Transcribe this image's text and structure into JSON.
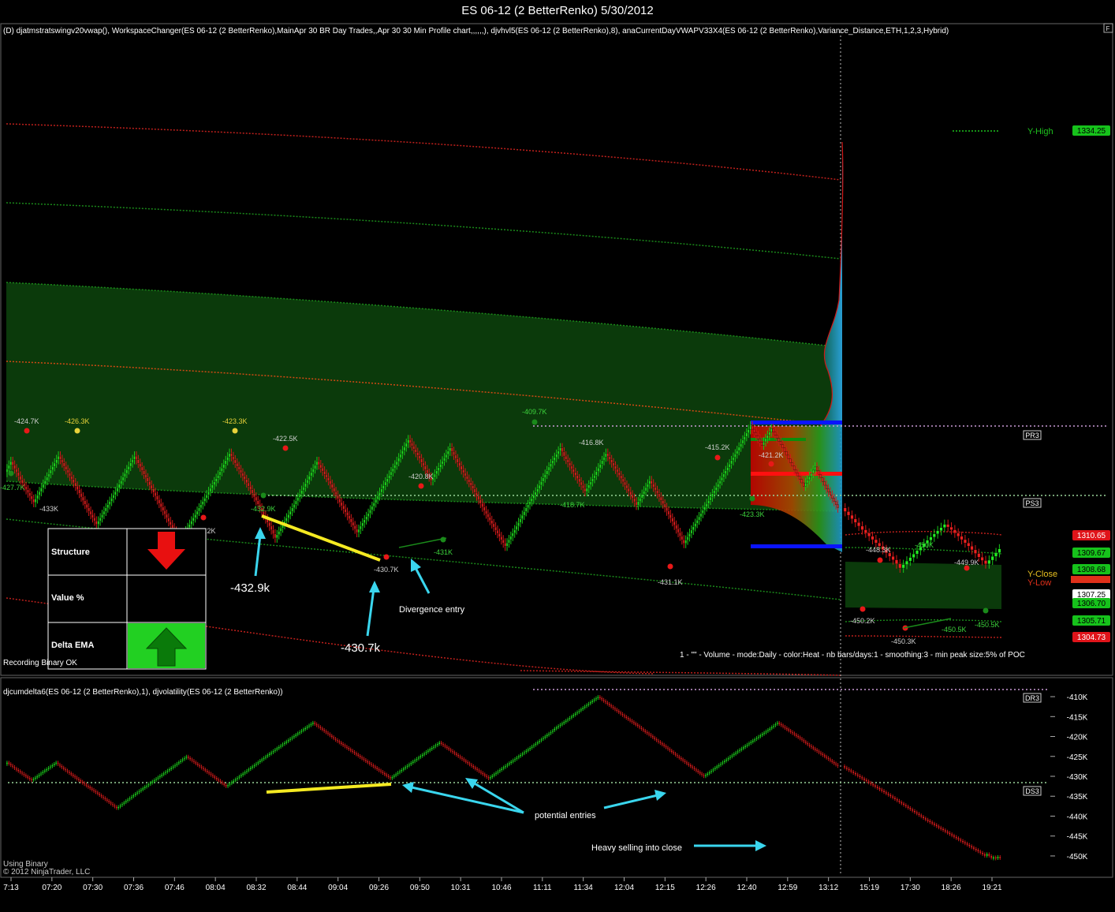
{
  "window": {
    "title": "ES 06-12 (2 BetterRenko)  5/30/2012",
    "corner_button": "F"
  },
  "price_panel": {
    "indicators": "(D) djatmstratswingv20vwap(), WorkspaceChanger(ES 06-12 (2 BetterRenko),MainApr 30 BR Day Trades,,Apr 30 30 Min Profile chart,,,,,,), djvhvl5(ES 06-12 (2 BetterRenko),8), anaCurrentDayVWAPV33X4(ES 06-12 (2 BetterRenko),Variance_Distance,ETH,1,2,3,Hybrid)",
    "status": "Recording Binary OK",
    "profile_caption": "1 - \"\" - Volume - mode:Daily  - color:Heat - nb bars/days:1 - smoothing:3 - min peak size:5% of POC",
    "level_tags": [
      "PR3",
      "PS3"
    ],
    "level_text": {
      "y_high": "Y-High",
      "y_close": "Y-Close",
      "y_low": "Y-Low"
    },
    "price_boxes": [
      {
        "label": "1334.25",
        "color": "#16c21b"
      },
      {
        "label": "1310.65",
        "color": "#e0141a"
      },
      {
        "label": "1309.67",
        "color": "#16c21b"
      },
      {
        "label": "1308.68",
        "color": "#16c21b"
      },
      {
        "label": "1307.25",
        "color": "#ffffff"
      },
      {
        "label": "1306.70",
        "color": "#16c21b"
      },
      {
        "label": "1305.71",
        "color": "#16c21b"
      },
      {
        "label": "1304.73",
        "color": "#e0141a"
      }
    ],
    "swing_labels": [
      {
        "text": "-424.7K",
        "color": "#cfcfcf"
      },
      {
        "text": "-426.3K",
        "color": "#e8d23a"
      },
      {
        "text": "-423.3K",
        "color": "#e8d23a"
      },
      {
        "text": "-422.5K",
        "color": "#cfcfcf"
      },
      {
        "text": "-420.8K",
        "color": "#cfcfcf"
      },
      {
        "text": "-409.7K",
        "color": "#3cd23c"
      },
      {
        "text": "-416.8K",
        "color": "#cfcfcf"
      },
      {
        "text": "-415.2K",
        "color": "#cfcfcf"
      },
      {
        "text": "-421.2K",
        "color": "#cfcfcf"
      },
      {
        "text": "-427.7K",
        "color": "#3cd23c"
      },
      {
        "text": "-433K",
        "color": "#cfcfcf"
      },
      {
        "text": "-440.2K",
        "color": "#cfcfcf"
      },
      {
        "text": "-432.9K",
        "color": "#3cd23c"
      },
      {
        "text": "-430.7K",
        "color": "#cfcfcf"
      },
      {
        "text": "-431K",
        "color": "#3cd23c"
      },
      {
        "text": "-418.7K",
        "color": "#3cd23c"
      },
      {
        "text": "-431.1K",
        "color": "#cfcfcf"
      },
      {
        "text": "-423.3K",
        "color": "#3cd23c"
      },
      {
        "text": "-448.3K",
        "color": "#cfcfcf"
      },
      {
        "text": "-450K",
        "color": "#3cd23c"
      },
      {
        "text": "-449.9K",
        "color": "#cfcfcf"
      },
      {
        "text": "-450.2K",
        "color": "#cfcfcf"
      },
      {
        "text": "-450.3K",
        "color": "#cfcfcf"
      },
      {
        "text": "-450.5K",
        "color": "#3cd23c"
      },
      {
        "text": "-450.5K",
        "color": "#3cd23c"
      }
    ],
    "annotations": [
      "-432.9k",
      "-430.7k",
      "Divergence entry"
    ],
    "legend_table": {
      "rows": [
        {
          "label": "Structure",
          "arrow": "down",
          "color": "#e81010"
        },
        {
          "label": "Value %",
          "arrow": "",
          "color": ""
        },
        {
          "label": "Delta EMA",
          "arrow": "up",
          "color": "#22d022"
        }
      ]
    }
  },
  "delta_panel": {
    "indicators": "djcumdelta6(ES 06-12 (2 BetterRenko),1), djvolatility(ES 06-12 (2 BetterRenko))",
    "level_tags": [
      "DR3",
      "DS3"
    ],
    "status": "Using Binary",
    "copyright": "© 2012 NinjaTrader, LLC",
    "annotations": [
      "potential entries",
      "Heavy selling into close"
    ],
    "y_ticks": [
      "-410K",
      "-415K",
      "-420K",
      "-425K",
      "-430K",
      "-435K",
      "-440K",
      "-445K",
      "-450K"
    ]
  },
  "chart_data": {
    "type": "bar",
    "title": "ES 06-12 (2 BetterRenko)  5/30/2012",
    "x_ticks": [
      "7:13",
      "07:20",
      "07:30",
      "07:36",
      "07:46",
      "08:04",
      "08:32",
      "08:44",
      "09:04",
      "09:26",
      "09:50",
      "10:31",
      "10:46",
      "11:11",
      "11:34",
      "12:04",
      "12:15",
      "12:26",
      "12:40",
      "12:59",
      "13:12",
      "15:19",
      "17:30",
      "18:26",
      "19:21"
    ],
    "price_series": [
      1306.2,
      1307.0,
      1305.4,
      1304.0,
      1305.6,
      1307.4,
      1306.4,
      1305.2,
      1303.6,
      1302.4,
      1304.8,
      1306.4,
      1307.4,
      1305.8,
      1304.2,
      1302.6,
      1301.2,
      1303.6,
      1306.0,
      1307.6,
      1305.2,
      1303.6,
      1302.0,
      1301.4,
      1303.6,
      1305.4,
      1307.0,
      1305.6,
      1304.0,
      1302.8,
      1301.8,
      1303.2,
      1305.0,
      1307.0,
      1308.6,
      1307.2,
      1305.6,
      1306.8,
      1308.0,
      1306.4,
      1305.0,
      1303.4,
      1302.2,
      1300.8,
      1302.0,
      1303.6,
      1305.0,
      1306.6,
      1308.0,
      1307.4,
      1306.2,
      1304.8,
      1306.0,
      1307.6,
      1306.2,
      1304.8,
      1303.8,
      1304.6,
      1305.6,
      1304.4,
      1302.6,
      1301.0,
      1303.2,
      1305.6,
      1307.8,
      1309.6,
      1308.2,
      1309.4,
      1308.0,
      1306.4,
      1305.2,
      1306.6,
      1305.0,
      1303.6,
      1302.0,
      1300.8,
      1299.8,
      1299.2,
      1301.0,
      1302.4,
      1302.0,
      1300.8,
      1300.0,
      1299.5,
      1300.6
    ],
    "delta_series": [
      -427.0,
      -426.5,
      -428.0,
      -431.0,
      -428.5,
      -426.5,
      -427.0,
      -428.5,
      -432.0,
      -434.0,
      -436.5,
      -438.0,
      -434.0,
      -427.5,
      -425.0,
      -430.0,
      -432.5,
      -425.0,
      -419.5,
      -416.5,
      -419.0,
      -420.5,
      -422.5,
      -424.5,
      -427.5,
      -430.5,
      -428.0,
      -423.5,
      -421.5,
      -426.0,
      -430.5,
      -427.0,
      -422.5,
      -418.5,
      -418.0,
      -416.0,
      -413.5,
      -411.0,
      -410.0,
      -412.5,
      -415.0,
      -417.0,
      -418.5,
      -419.5,
      -421.0,
      -422.0,
      -423.5,
      -425.0,
      -427.5,
      -430.0,
      -427.5,
      -424.0,
      -421.0,
      -418.0,
      -416.5,
      -418.5,
      -420.5,
      -422.0,
      -425.0,
      -429.5,
      -435.0,
      -439.0,
      -440.5,
      -442.5,
      -444.5,
      -446.5,
      -448.5,
      -449.5,
      -450.0,
      -449.5,
      -450.0,
      -450.5,
      -450.3,
      -450.5,
      -450.2,
      -450.4
    ],
    "y_range_price": [
      1295.0,
      1312.0
    ],
    "y_range_delta": [
      -451.0,
      -409.0
    ],
    "grid": false
  }
}
